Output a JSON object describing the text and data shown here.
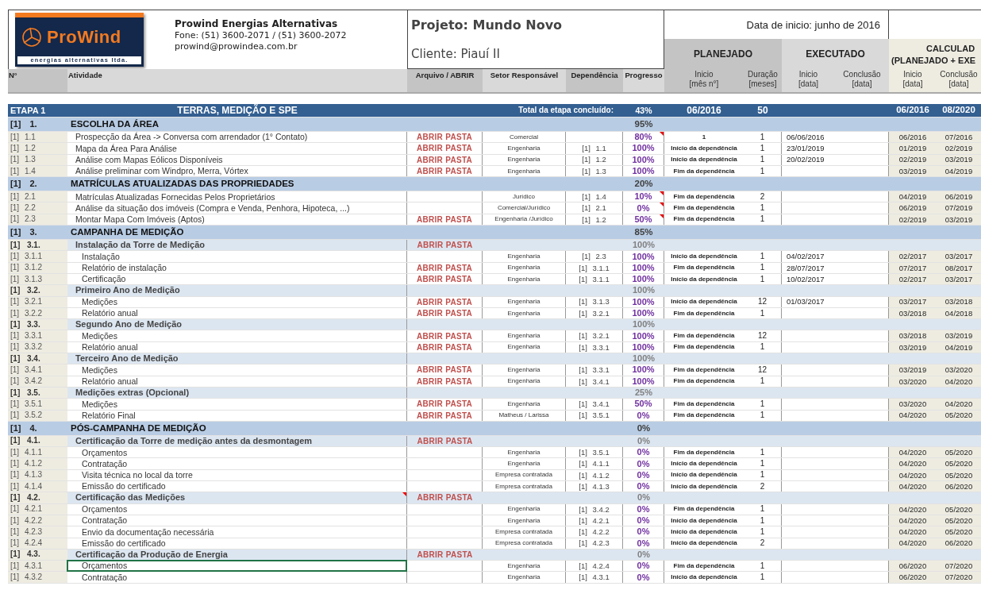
{
  "company": {
    "logo_name": "ProWind",
    "logo_tagline": "energias alternativas ltda.",
    "name": "Prowind Energias Alternativas",
    "phone": "Fone: (51) 3600-2071 / (51) 3600-2072",
    "email": "prowind@prowindea.com.br"
  },
  "project": {
    "title": "Projeto: Mundo Novo",
    "client": "Cliente: Piauí II"
  },
  "start_date": "Data de inicio: junho de 2016",
  "column_groups": {
    "planned": "PLANEJADO",
    "executed": "EXECUTADO",
    "calculated": "CALCULAD",
    "calculated_note": "(PLANEJADO + EXE"
  },
  "columns": [
    {
      "label": "N°"
    },
    {
      "label": "Atividade"
    },
    {
      "label": "Arquivo / ABRIR"
    },
    {
      "label": "Setor Responsável"
    },
    {
      "label": "Dependência"
    },
    {
      "label": "Progresso"
    },
    {
      "label": "Inicio",
      "unit": "[mês n°]"
    },
    {
      "label": "Duração",
      "unit": "[meses]"
    },
    {
      "label": "Inicio",
      "unit": "[data]"
    },
    {
      "label": "Conclusão",
      "unit": "[data]"
    },
    {
      "label": "Inicio",
      "unit": "[data]"
    },
    {
      "label": "Conclusão",
      "unit": "[data]"
    }
  ],
  "stage": {
    "label": "ETAPA 1",
    "title": "TERRAS, MEDIÇÃO E SPE",
    "total_label": "Total da etapa concluído:",
    "progress": "43%",
    "plan_start": "06/2016",
    "duration": "50",
    "calc_start": "06/2016",
    "calc_end": "08/2020",
    "sections": [
      {
        "number": "[1] 1.",
        "title": "ESCOLHA DA ÁREA",
        "progress": "95%",
        "children": [
          {
            "kind": "task",
            "number": "[1] 1.1",
            "title": "Prospecção da Área -> Conversa com arrendador (1° Contato)",
            "file": "ABRIR PASTA",
            "sector": "Comercial",
            "progress": "80%",
            "comment": true,
            "plan_start": "1",
            "duration": "1",
            "exec_start": "06/06/2016",
            "calc_start": "06/2016",
            "calc_end": "07/2016"
          },
          {
            "kind": "task",
            "number": "[1] 1.2",
            "title": "Mapa da Área Para Análise",
            "file": "ABRIR PASTA",
            "sector": "Engenharia",
            "dependency": "[1] 1.1",
            "progress": "100%",
            "plan_start": "Início da dependência",
            "duration": "1",
            "exec_start": "23/01/2019",
            "calc_start": "01/2019",
            "calc_end": "02/2019"
          },
          {
            "kind": "task",
            "number": "[1] 1.3",
            "title": "Análise com Mapas Eólicos Disponíveis",
            "file": "ABRIR PASTA",
            "sector": "Engenharia",
            "dependency": "[1] 1.2",
            "progress": "100%",
            "plan_start": "Início da dependência",
            "duration": "1",
            "exec_start": "20/02/2019",
            "calc_start": "02/2019",
            "calc_end": "03/2019"
          },
          {
            "kind": "task",
            "number": "[1] 1.4",
            "title": "Análise preliminar com Windpro, Merra, Vórtex",
            "file": "ABRIR PASTA",
            "sector": "Engenharia",
            "dependency": "[1] 1.3",
            "progress": "100%",
            "plan_start": "Fim da dependência",
            "duration": "1",
            "calc_start": "03/2019",
            "calc_end": "04/2019"
          }
        ]
      },
      {
        "number": "[1] 2.",
        "title": "MATRÍCULAS ATUALIZADAS DAS PROPRIEDADES",
        "progress": "20%",
        "children": [
          {
            "kind": "task",
            "number": "[1] 2.1",
            "title": "Matrículas Atualizadas Fornecidas Pelos Proprietários",
            "sector": "Jurídico",
            "dependency": "[1] 1.4",
            "progress": "10%",
            "comment": true,
            "plan_start": "Fim da dependência",
            "duration": "2",
            "calc_start": "04/2019",
            "calc_end": "06/2019"
          },
          {
            "kind": "task",
            "number": "[1] 2.2",
            "title": "Análise da situação dos imóveis (Compra e Venda, Penhora, Hipoteca, ...)",
            "sector": "Comercial/Jurídico",
            "dependency": "[1] 2.1",
            "progress": "0%",
            "comment": true,
            "plan_start": "Fim da dependência",
            "duration": "1",
            "calc_start": "06/2019",
            "calc_end": "07/2019"
          },
          {
            "kind": "task",
            "number": "[1] 2.3",
            "title": "Montar Mapa Com Imóveis (Aptos)",
            "file": "ABRIR PASTA",
            "sector": "Engenharia /Jurídico",
            "dependency": "[1] 1.2",
            "progress": "50%",
            "comment": true,
            "plan_start": "Fim da dependência",
            "duration": "1",
            "calc_start": "02/2019",
            "calc_end": "03/2019"
          }
        ]
      },
      {
        "number": "[1] 3.",
        "title": "CAMPANHA DE MEDIÇÃO",
        "progress": "85%",
        "children": [
          {
            "kind": "group",
            "number": "[1] 3.1.",
            "title": "Instalação da Torre de Medição",
            "file": "ABRIR PASTA",
            "progress": "100%",
            "children": [
              {
                "kind": "task",
                "number": "[1] 3.1.1",
                "title": "Instalação",
                "sector": "Engenharia",
                "dependency": "[1] 2.3",
                "progress": "100%",
                "plan_start": "Início da dependência",
                "duration": "1",
                "exec_start": "04/02/2017",
                "calc_start": "02/2017",
                "calc_end": "03/2017"
              },
              {
                "kind": "task",
                "number": "[1] 3.1.2",
                "title": "Relatório de instalação",
                "file": "ABRIR PASTA",
                "sector": "Engenharia",
                "dependency": "[1] 3.1.1",
                "progress": "100%",
                "plan_start": "Fim da dependência",
                "duration": "1",
                "exec_start": "28/07/2017",
                "calc_start": "07/2017",
                "calc_end": "08/2017"
              },
              {
                "kind": "task",
                "number": "[1] 3.1.3",
                "title": "Certificação",
                "file": "ABRIR PASTA",
                "sector": "Engenharia",
                "dependency": "[1] 3.1.1",
                "progress": "100%",
                "plan_start": "Início da dependência",
                "duration": "1",
                "exec_start": "10/02/2017",
                "calc_start": "02/2017",
                "calc_end": "03/2017"
              }
            ]
          },
          {
            "kind": "group",
            "number": "[1] 3.2.",
            "title": "Primeiro Ano de Medição",
            "progress": "100%",
            "children": [
              {
                "kind": "task",
                "number": "[1] 3.2.1",
                "title": "Medições",
                "file": "ABRIR PASTA",
                "sector": "Engenharia",
                "dependency": "[1] 3.1.3",
                "progress": "100%",
                "plan_start": "Início da dependência",
                "duration": "12",
                "exec_start": "01/03/2017",
                "calc_start": "03/2017",
                "calc_end": "03/2018"
              },
              {
                "kind": "task",
                "number": "[1] 3.2.2",
                "title": "Relatório anual",
                "file": "ABRIR PASTA",
                "sector": "Engenharia",
                "dependency": "[1] 3.2.1",
                "progress": "100%",
                "plan_start": "Fim da dependência",
                "duration": "1",
                "calc_start": "03/2018",
                "calc_end": "04/2018"
              }
            ]
          },
          {
            "kind": "group",
            "number": "[1] 3.3.",
            "title": "Segundo Ano de Medição",
            "progress": "100%",
            "children": [
              {
                "kind": "task",
                "number": "[1] 3.3.1",
                "title": "Medições",
                "file": "ABRIR PASTA",
                "sector": "Engenharia",
                "dependency": "[1] 3.2.1",
                "progress": "100%",
                "plan_start": "Fim da dependência",
                "duration": "12",
                "calc_start": "03/2018",
                "calc_end": "03/2019"
              },
              {
                "kind": "task",
                "number": "[1] 3.3.2",
                "title": "Relatório anual",
                "file": "ABRIR PASTA",
                "sector": "Engenharia",
                "dependency": "[1] 3.3.1",
                "progress": "100%",
                "plan_start": "Fim da dependência",
                "duration": "1",
                "calc_start": "03/2019",
                "calc_end": "04/2019"
              }
            ]
          },
          {
            "kind": "group",
            "number": "[1] 3.4.",
            "title": "Terceiro Ano de Medição",
            "progress": "100%",
            "children": [
              {
                "kind": "task",
                "number": "[1] 3.4.1",
                "title": "Medições",
                "file": "ABRIR PASTA",
                "sector": "Engenharia",
                "dependency": "[1] 3.3.1",
                "progress": "100%",
                "plan_start": "Fim da dependência",
                "duration": "12",
                "calc_start": "03/2019",
                "calc_end": "03/2020"
              },
              {
                "kind": "task",
                "number": "[1] 3.4.2",
                "title": "Relatório anual",
                "file": "ABRIR PASTA",
                "sector": "Engenharia",
                "dependency": "[1] 3.4.1",
                "progress": "100%",
                "plan_start": "Fim da dependência",
                "duration": "1",
                "calc_start": "03/2020",
                "calc_end": "04/2020"
              }
            ]
          },
          {
            "kind": "group",
            "number": "[1] 3.5.",
            "title": "Medições extras (Opcional)",
            "progress": "25%",
            "children": [
              {
                "kind": "task",
                "number": "[1] 3.5.1",
                "title": "Medições",
                "file": "ABRIR PASTA",
                "sector": "Engenharia",
                "dependency": "[1] 3.4.1",
                "progress": "50%",
                "plan_start": "Fim da dependência",
                "duration": "1",
                "calc_start": "03/2020",
                "calc_end": "04/2020"
              },
              {
                "kind": "task",
                "number": "[1] 3.5.2",
                "title": "Relatório Final",
                "file": "ABRIR PASTA",
                "sector": "Matheus / Larissa",
                "dependency": "[1] 3.5.1",
                "progress": "0%",
                "plan_start": "Fim da dependência",
                "duration": "1",
                "calc_start": "04/2020",
                "calc_end": "05/2020"
              }
            ]
          }
        ]
      },
      {
        "number": "[1] 4.",
        "title": "PÓS-CAMPANHA DE MEDIÇÃO",
        "progress": "0%",
        "children": [
          {
            "kind": "group",
            "number": "[1] 4.1.",
            "title": "Certificação da Torre de medição antes da desmontagem",
            "file": "ABRIR PASTA",
            "progress": "0%",
            "children": [
              {
                "kind": "task",
                "number": "[1] 4.1.1",
                "title": "Orçamentos",
                "sector": "Engenharia",
                "dependency": "[1] 3.5.1",
                "progress": "0%",
                "plan_start": "Fim da dependência",
                "duration": "1",
                "calc_start": "04/2020",
                "calc_end": "05/2020"
              },
              {
                "kind": "task",
                "number": "[1] 4.1.2",
                "title": "Contratação",
                "sector": "Engenharia",
                "dependency": "[1] 4.1.1",
                "progress": "0%",
                "plan_start": "Início da dependência",
                "duration": "1",
                "calc_start": "04/2020",
                "calc_end": "05/2020"
              },
              {
                "kind": "task",
                "number": "[1] 4.1.3",
                "title": "Visita técnica no local da torre",
                "sector": "Empresa contratada",
                "dependency": "[1] 4.1.2",
                "progress": "0%",
                "plan_start": "Início da dependência",
                "duration": "1",
                "calc_start": "04/2020",
                "calc_end": "05/2020"
              },
              {
                "kind": "task",
                "number": "[1] 4.1.4",
                "title": "Emissão do certificado",
                "sector": "Empresa contratada",
                "dependency": "[1] 4.1.3",
                "progress": "0%",
                "plan_start": "Início da dependência",
                "duration": "2",
                "calc_start": "04/2020",
                "calc_end": "06/2020"
              }
            ]
          },
          {
            "kind": "group",
            "number": "[1] 4.2.",
            "title": "Certificação das Medições",
            "file": "ABRIR PASTA",
            "progress": "0%",
            "comment": true,
            "children": [
              {
                "kind": "task",
                "number": "[1] 4.2.1",
                "title": "Orçamentos",
                "sector": "Engenharia",
                "dependency": "[1] 3.4.2",
                "progress": "0%",
                "plan_start": "Fim da dependência",
                "duration": "1",
                "calc_start": "04/2020",
                "calc_end": "05/2020"
              },
              {
                "kind": "task",
                "number": "[1] 4.2.2",
                "title": "Contratação",
                "sector": "Engenharia",
                "dependency": "[1] 4.2.1",
                "progress": "0%",
                "plan_start": "Início da dependência",
                "duration": "1",
                "calc_start": "04/2020",
                "calc_end": "05/2020"
              },
              {
                "kind": "task",
                "number": "[1] 4.2.3",
                "title": "Envio da documentação necessária",
                "sector": "Empresa contratada",
                "dependency": "[1] 4.2.2",
                "progress": "0%",
                "plan_start": "Início da dependência",
                "duration": "1",
                "calc_start": "04/2020",
                "calc_end": "05/2020"
              },
              {
                "kind": "task",
                "number": "[1] 4.2.4",
                "title": "Emissão do certificado",
                "sector": "Empresa contratada",
                "dependency": "[1] 4.2.3",
                "progress": "0%",
                "plan_start": "Início da dependência",
                "duration": "2",
                "calc_start": "04/2020",
                "calc_end": "06/2020"
              }
            ]
          },
          {
            "kind": "group",
            "number": "[1] 4.3.",
            "title": "Certificação da Produção de Energia",
            "file": "ABRIR PASTA",
            "progress": "0%",
            "children": [
              {
                "kind": "task",
                "number": "[1] 4.3.1",
                "title": "Orçamentos",
                "selected": true,
                "sector": "Engenharia",
                "dependency": "[1] 4.2.4",
                "progress": "0%",
                "plan_start": "Fim da dependência",
                "duration": "1",
                "calc_start": "06/2020",
                "calc_end": "07/2020"
              },
              {
                "kind": "task",
                "number": "[1] 4.3.2",
                "title": "Contratação",
                "sector": "Engenharia",
                "dependency": "[1] 4.3.1",
                "progress": "0%",
                "plan_start": "Início da dependência",
                "duration": "1",
                "calc_start": "06/2020",
                "calc_end": "07/2020"
              }
            ]
          }
        ]
      }
    ]
  }
}
